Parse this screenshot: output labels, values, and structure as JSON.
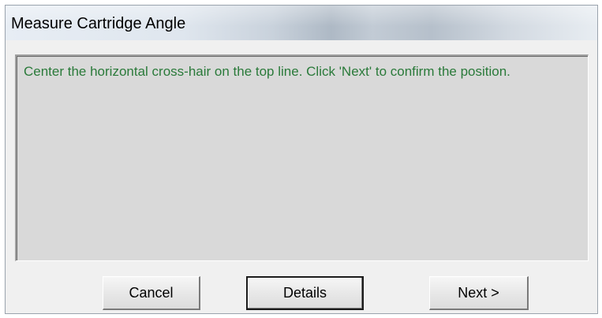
{
  "window": {
    "title": "Measure Cartridge Angle"
  },
  "message": {
    "text": "Center the horizontal cross-hair on the top line. Click 'Next' to confirm the position."
  },
  "buttons": {
    "cancel_label": "Cancel",
    "details_label": "Details",
    "next_label": "Next >"
  },
  "colors": {
    "message_text": "#2a7a3a",
    "message_background": "#d9d9d9",
    "dialog_background": "#f0f0f0"
  }
}
